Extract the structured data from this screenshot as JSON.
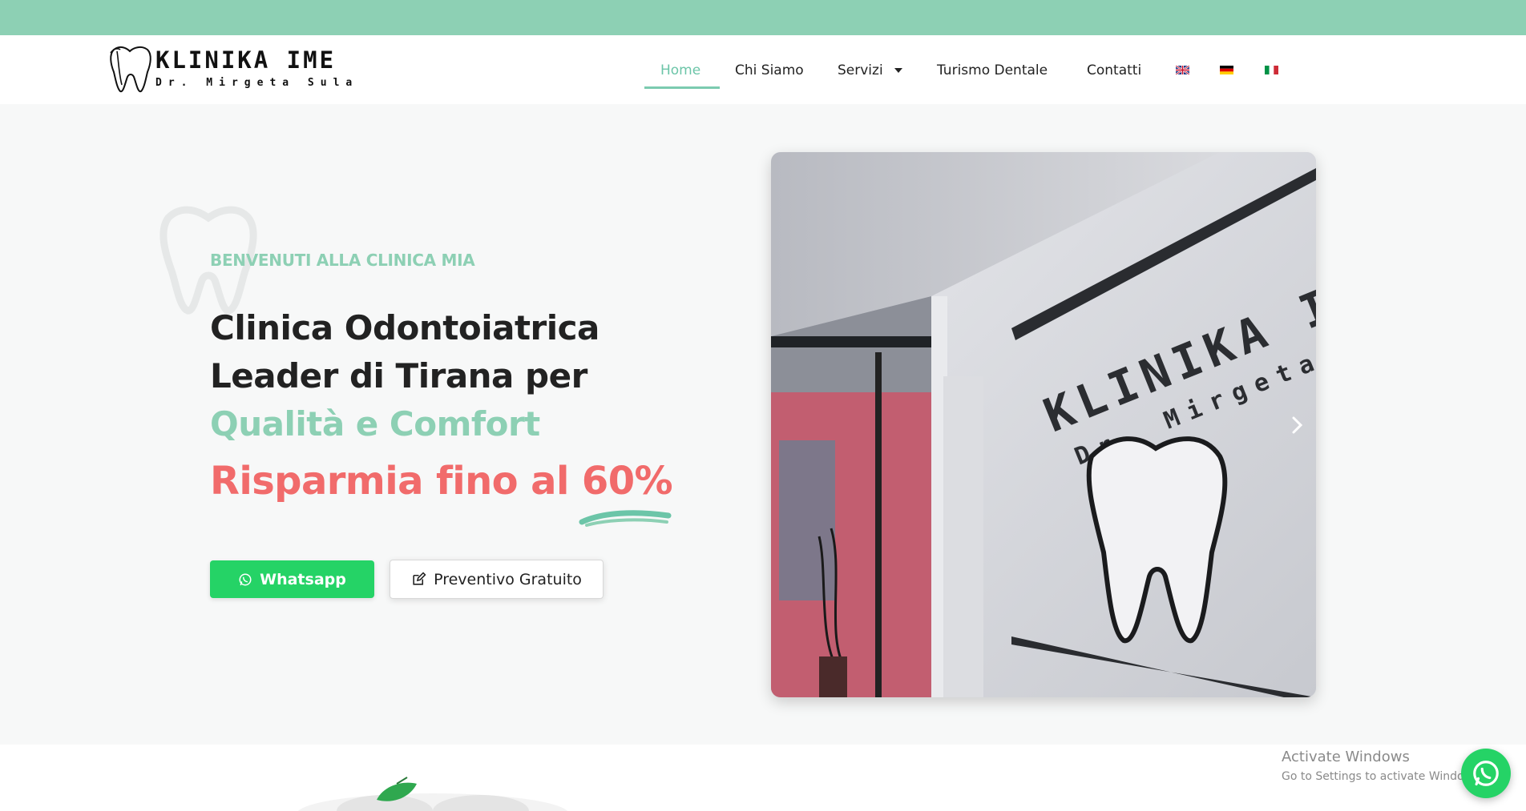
{
  "brand": {
    "logo_title": "KLINIKA IME",
    "logo_subtitle": "Dr. Mirgeta Sula",
    "accent": "#8dd0b4",
    "highlight": "#f16b6b",
    "whatsapp_green": "#25d366"
  },
  "nav": {
    "items": [
      {
        "label": "Home",
        "active": true
      },
      {
        "label": "Chi Siamo"
      },
      {
        "label": "Servizi",
        "has_dropdown": true
      },
      {
        "label": "Turismo Dentale"
      },
      {
        "label": "Contatti"
      }
    ],
    "languages": [
      "en-flag",
      "de-flag",
      "it-flag"
    ]
  },
  "hero": {
    "eyebrow": "BENVENUTI ALLA CLINICA MIA",
    "headline_line1": "Clinica Odontoiatrica",
    "headline_line2": "Leader di Tirana per",
    "headline_accent": "Qualità e Comfort",
    "savings": "Risparmia fino al 60%",
    "whatsapp_label": "Whatsapp",
    "quote_label": "Preventivo Gratuito",
    "image_alt": "KLINIKA IME Dr. Mirgeta Sula",
    "slider_next": "chevron-right-icon"
  },
  "system": {
    "activate_title": "Activate Windows",
    "activate_sub": "Go to Settings to activate Windows."
  }
}
